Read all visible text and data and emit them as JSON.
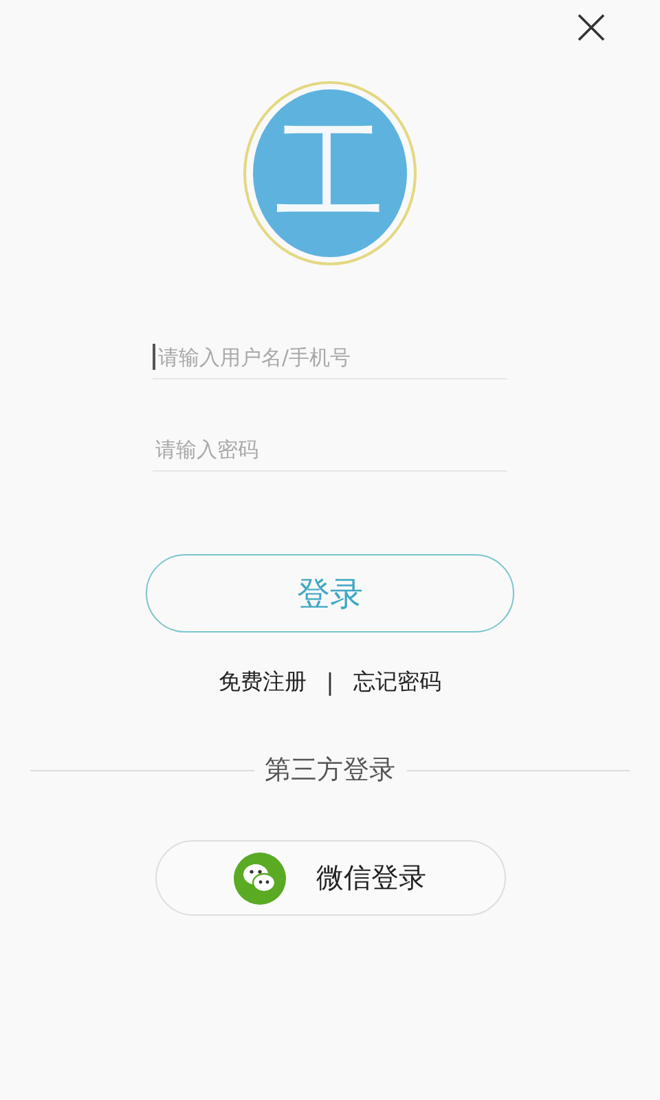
{
  "logo": {
    "text": "工"
  },
  "fields": [
    {
      "placeholder": "请输入用户名/手机号",
      "focused": true
    },
    {
      "placeholder": "请输入密码",
      "focused": false
    }
  ],
  "login_button": "登录",
  "links": [
    "免费注册",
    "忘记密码"
  ],
  "link_separator": "|",
  "third_party": {
    "title": "第三方登录",
    "button": "微信登录"
  }
}
